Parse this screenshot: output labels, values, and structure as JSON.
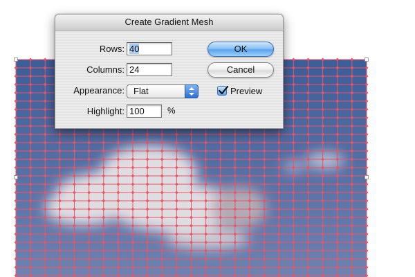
{
  "dialog": {
    "title": "Create Gradient Mesh",
    "rows_label": "Rows:",
    "rows_value": "40",
    "columns_label": "Columns:",
    "columns_value": "24",
    "appearance_label": "Appearance:",
    "appearance_value": "Flat",
    "highlight_label": "Highlight:",
    "highlight_value": "100",
    "highlight_unit": "%",
    "ok_label": "OK",
    "cancel_label": "Cancel",
    "preview_label": "Preview",
    "preview_checked": true
  },
  "colors": {
    "mesh_line": "#e8556a",
    "sky_top": "#3d5d98",
    "sky_bottom": "#6f82b0",
    "cloud": "#e7e3e4",
    "accent_blue": "#5aa3ec"
  },
  "icons": {
    "popup_arrows": "up-down-arrows-icon",
    "check": "checkmark-icon"
  }
}
